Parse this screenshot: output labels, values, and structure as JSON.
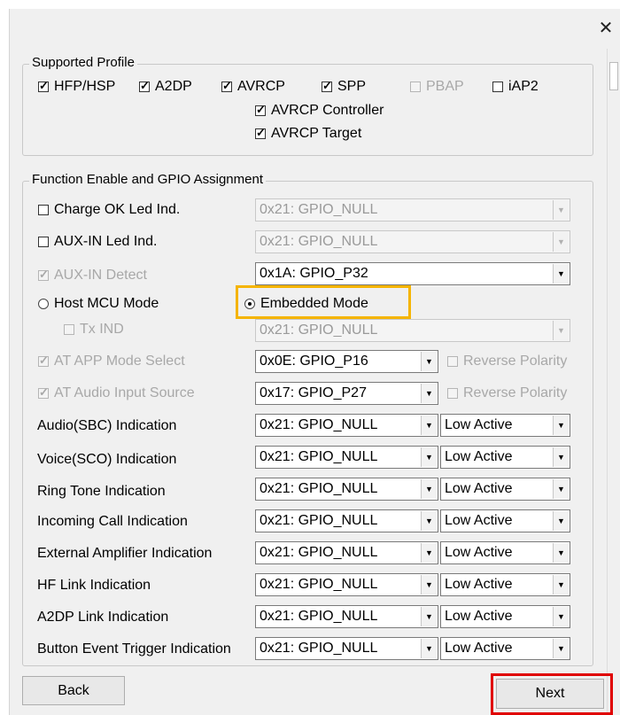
{
  "window": {
    "close_glyph": "✕"
  },
  "supported_profile": {
    "legend": "Supported Profile",
    "items": [
      {
        "label": "HFP/HSP",
        "checked": true,
        "enabled": true
      },
      {
        "label": "A2DP",
        "checked": true,
        "enabled": true
      },
      {
        "label": "AVRCP",
        "checked": true,
        "enabled": true
      },
      {
        "label": "SPP",
        "checked": true,
        "enabled": true
      },
      {
        "label": "PBAP",
        "checked": false,
        "enabled": false
      },
      {
        "label": "iAP2",
        "checked": false,
        "enabled": true
      },
      {
        "label": "AVRCP Controller",
        "checked": true,
        "enabled": true
      },
      {
        "label": "AVRCP Target",
        "checked": true,
        "enabled": true
      }
    ]
  },
  "function_group": {
    "legend": "Function Enable and GPIO Assignment",
    "charge_ok": {
      "label": "Charge OK Led Ind.",
      "checked": false,
      "gpio": "0x21:  GPIO_NULL"
    },
    "aux_led": {
      "label": "AUX-IN Led Ind.",
      "checked": false,
      "gpio": "0x21:  GPIO_NULL"
    },
    "aux_detect": {
      "label": "AUX-IN Detect",
      "checked": true,
      "gpio": "0x1A:  GPIO_P32"
    },
    "host_mcu": {
      "label": "Host MCU Mode",
      "selected": false
    },
    "embedded": {
      "label": "Embedded Mode",
      "selected": true
    },
    "tx_ind": {
      "label": "Tx IND",
      "checked": false,
      "gpio": "0x21:  GPIO_NULL"
    },
    "at_app": {
      "label": "AT APP Mode Select",
      "checked": true,
      "gpio": "0x0E:  GPIO_P16",
      "reverse": "Reverse Polarity"
    },
    "at_audio": {
      "label": "AT Audio Input Source",
      "checked": true,
      "gpio": "0x17:  GPIO_P27",
      "reverse": "Reverse Polarity"
    },
    "indications": [
      {
        "label": "Audio(SBC) Indication",
        "gpio": "0x21:  GPIO_NULL",
        "active": "Low Active"
      },
      {
        "label": "Voice(SCO) Indication",
        "gpio": "0x21:  GPIO_NULL",
        "active": "Low Active"
      },
      {
        "label": "Ring Tone Indication",
        "gpio": "0x21:  GPIO_NULL",
        "active": "Low Active"
      },
      {
        "label": "Incoming Call Indication",
        "gpio": "0x21:  GPIO_NULL",
        "active": "Low Active"
      },
      {
        "label": "External Amplifier Indication",
        "gpio": "0x21:  GPIO_NULL",
        "active": "Low Active"
      },
      {
        "label": "HF Link Indication",
        "gpio": "0x21:  GPIO_NULL",
        "active": "Low Active"
      },
      {
        "label": "A2DP Link Indication",
        "gpio": "0x21:  GPIO_NULL",
        "active": "Low Active"
      },
      {
        "label": "Button Event Trigger Indication",
        "gpio": "0x21:  GPIO_NULL",
        "active": "Low Active"
      }
    ]
  },
  "buttons": {
    "back": "Back",
    "next": "Next"
  },
  "highlight_colors": {
    "embedded_mode": "#f5b400",
    "next_button": "#e00000"
  },
  "icons": {
    "dropdown": "chevron-down-icon",
    "close": "close-icon"
  }
}
